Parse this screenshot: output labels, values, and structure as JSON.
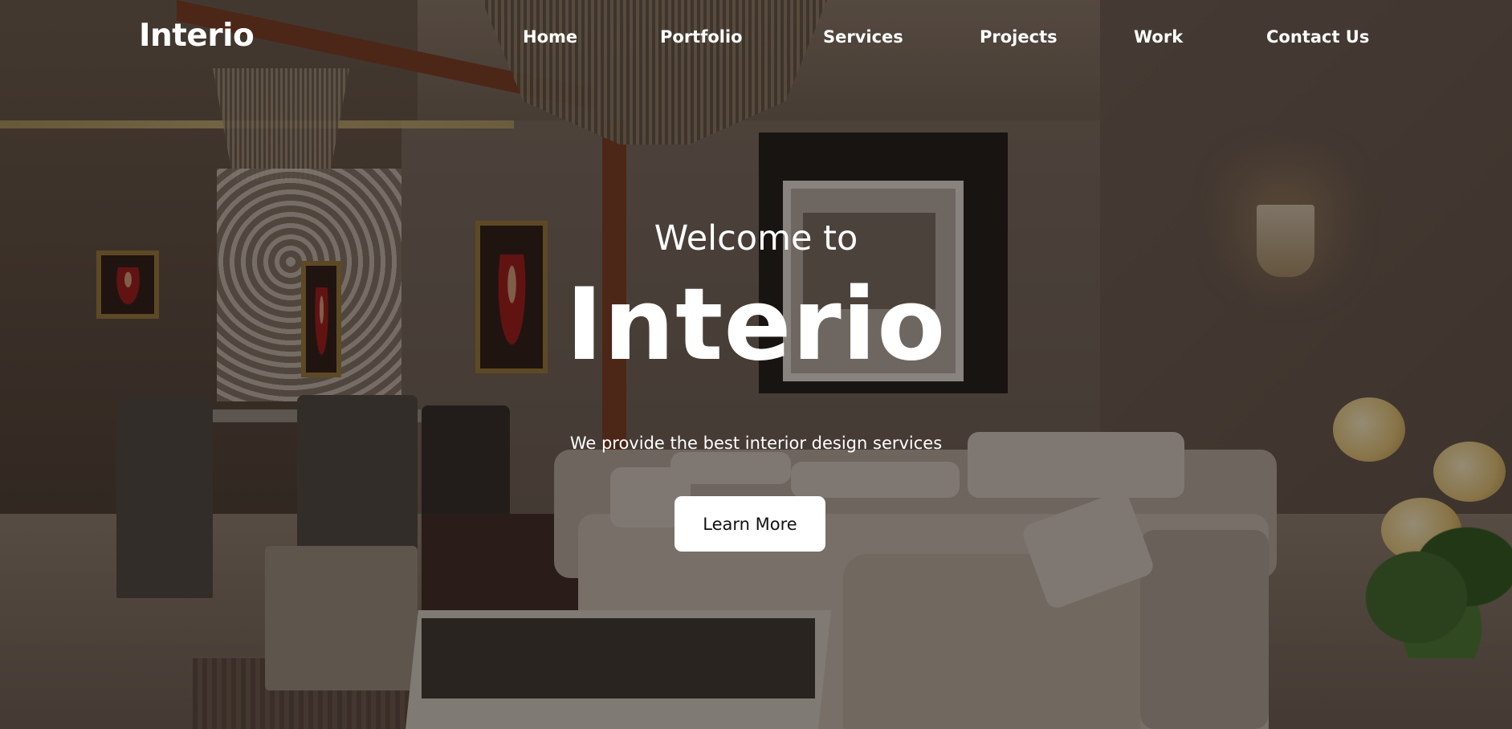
{
  "brand": {
    "logo_text": "Interio"
  },
  "nav": {
    "items": [
      {
        "label": "Home"
      },
      {
        "label": "Portfolio"
      },
      {
        "label": "Services"
      },
      {
        "label": "Projects"
      },
      {
        "label": "Work"
      },
      {
        "label": "Contact Us"
      }
    ]
  },
  "hero": {
    "welcome_text": "Welcome to",
    "title": "Interio",
    "tagline": "We provide the best interior design services",
    "cta_label": "Learn More",
    "background_image": "living-room-interior-photo"
  },
  "colors": {
    "text": "#ffffff",
    "button_bg": "#ffffff",
    "button_text": "#111111",
    "overlay": "rgba(20,14,10,0.45)"
  }
}
